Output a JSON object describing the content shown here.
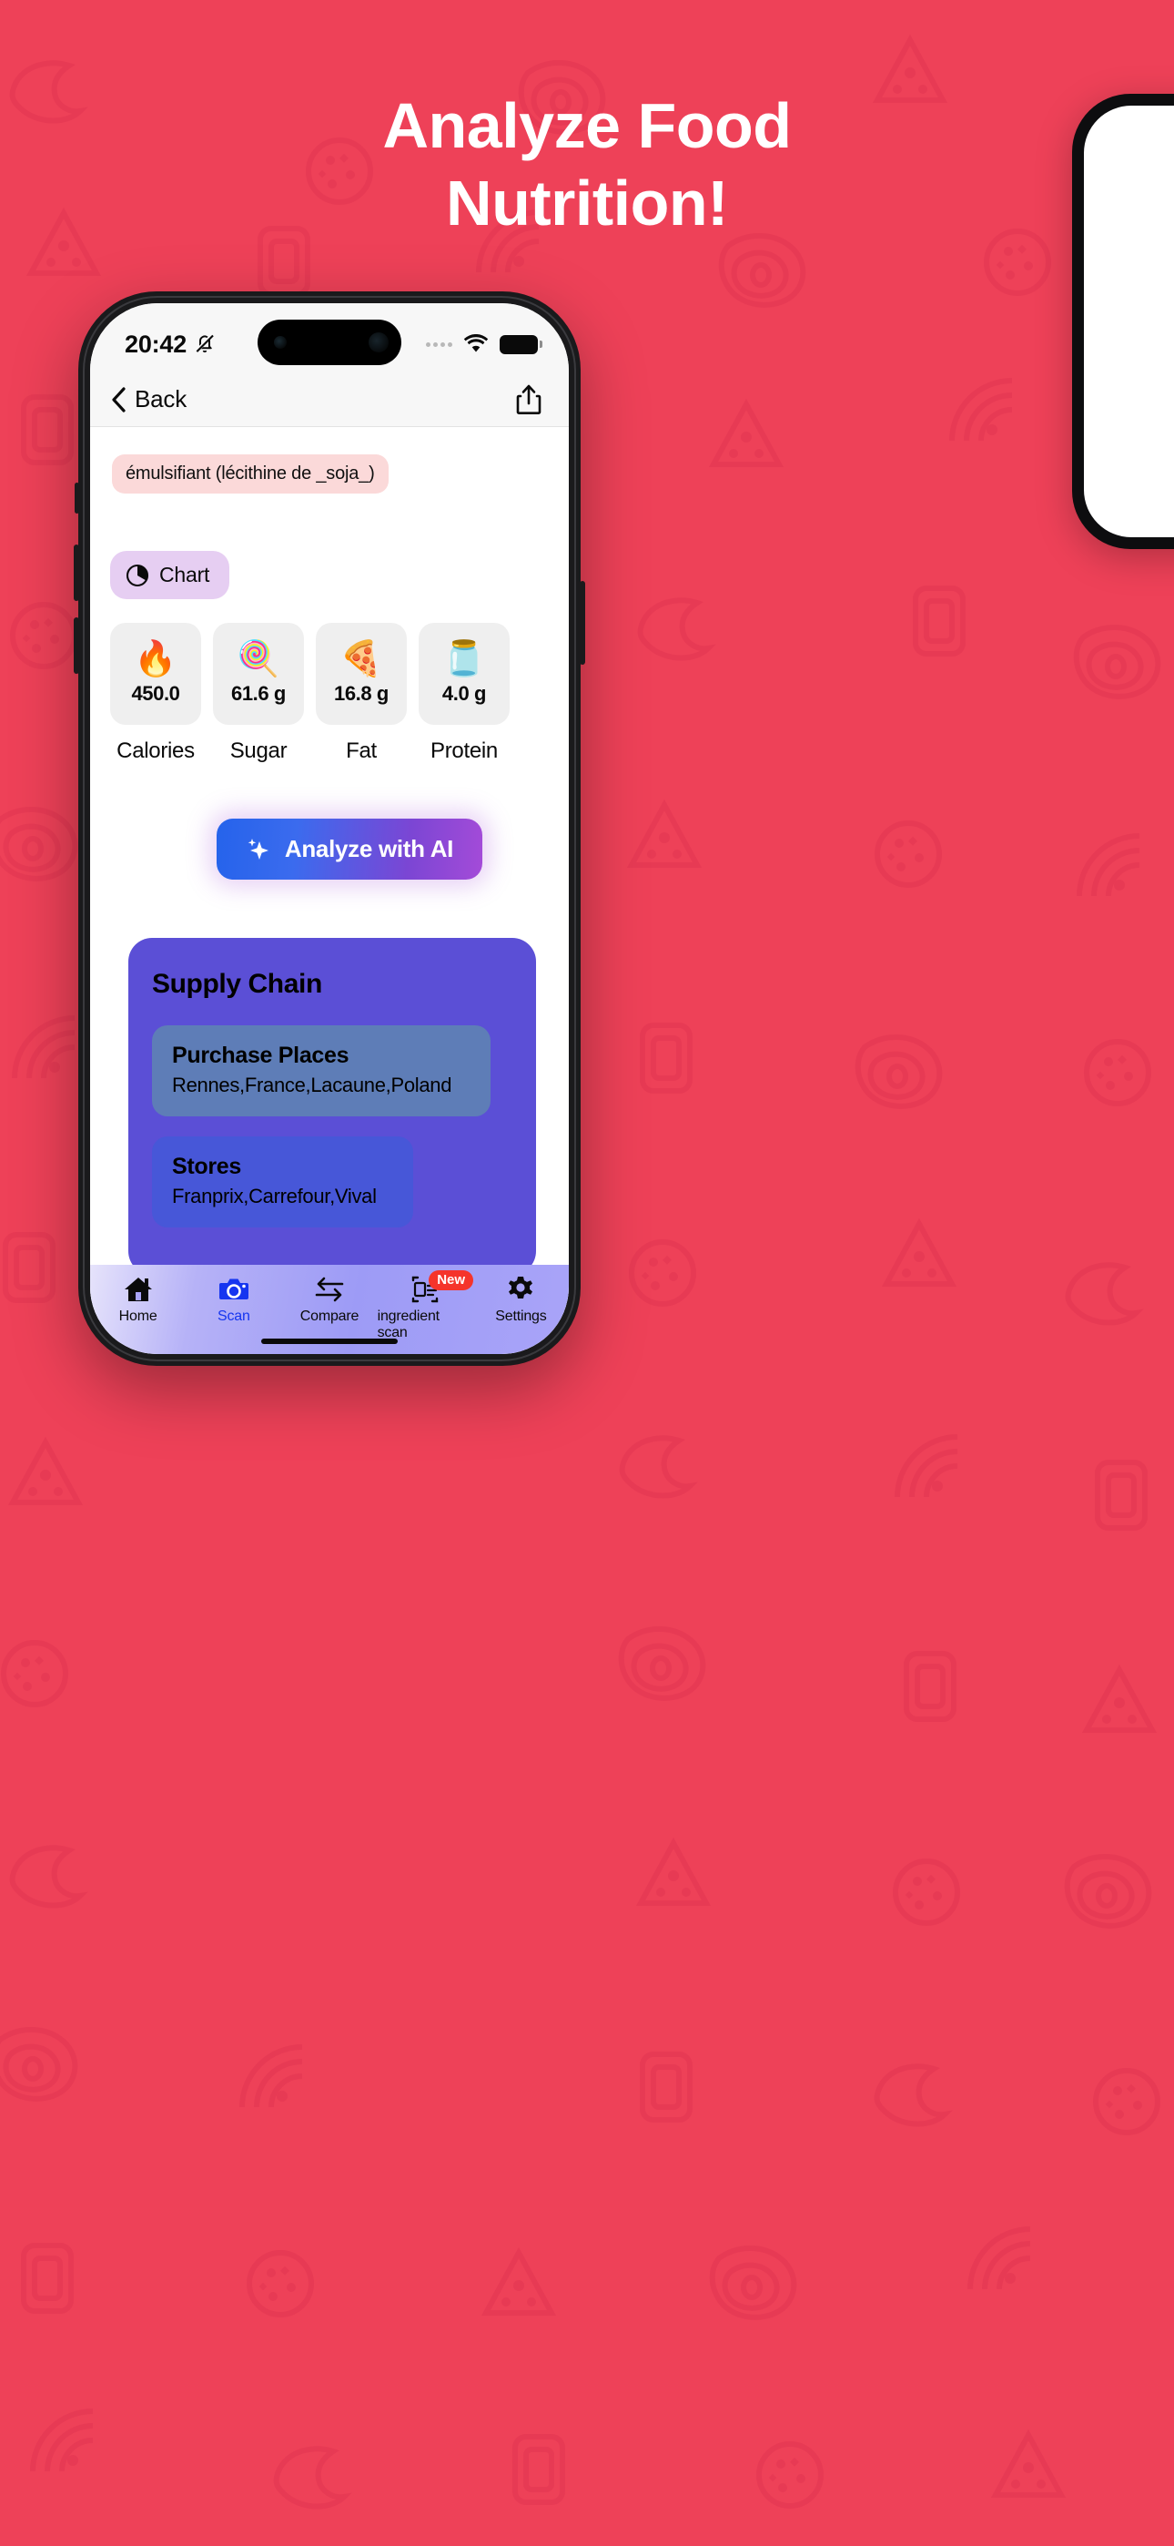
{
  "promo": {
    "headline_line1": "Analyze Food",
    "headline_line2": "Nutrition!",
    "background_color": "#EE4158"
  },
  "status_bar": {
    "time": "20:42",
    "silent_icon": "bell-slash-icon",
    "signal_icon": "signal-dots-icon",
    "wifi_icon": "wifi-icon",
    "battery_icon": "battery-full-icon"
  },
  "nav": {
    "back_label": "Back",
    "back_icon": "chevron-left-icon",
    "share_icon": "share-icon"
  },
  "ingredients": {
    "tag": "émulsifiant (lécithine de _soja_)",
    "tag_bg": "#FBD9D9"
  },
  "chart_chip": {
    "label": "Chart",
    "icon": "pie-chart-icon",
    "bg": "#E6CEF2"
  },
  "nutrition": {
    "cards": [
      {
        "emoji": "🔥",
        "icon": "kcal-flame-icon",
        "value": "450.0",
        "label": "Calories"
      },
      {
        "emoji": "🍭",
        "icon": "lollipop-icon",
        "value": "61.6 g",
        "label": "Sugar"
      },
      {
        "emoji": "🍕",
        "icon": "pizza-icon",
        "value": "16.8 g",
        "label": "Fat"
      },
      {
        "emoji": "🫙",
        "icon": "protein-jar-icon",
        "value": "4.0 g",
        "label": "Protein"
      }
    ]
  },
  "ai_button": {
    "label": "Analyze with AI",
    "icon": "sparkle-icon",
    "gradient_from": "#2563EB",
    "gradient_to": "#A44BD8"
  },
  "supply_chain": {
    "title": "Supply Chain",
    "bg": "#5B4FD6",
    "cards": [
      {
        "title": "Purchase Places",
        "value": "Rennes,France,Lacaune,Poland",
        "bg": "#5E7DB7"
      },
      {
        "title": "Stores",
        "value": "Franprix,Carrefour,Vival",
        "bg": "#4757D8"
      }
    ]
  },
  "tab_bar": {
    "items": [
      {
        "label": "Home",
        "icon": "home-icon",
        "active": false,
        "badge": ""
      },
      {
        "label": "Scan",
        "icon": "camera-icon",
        "active": true,
        "badge": ""
      },
      {
        "label": "Compare",
        "icon": "compare-arrows-icon",
        "active": false,
        "badge": ""
      },
      {
        "label": "ingredient scan",
        "icon": "document-scan-icon",
        "active": false,
        "badge": "New"
      },
      {
        "label": "Settings",
        "icon": "gear-icon",
        "active": false,
        "badge": ""
      }
    ]
  }
}
